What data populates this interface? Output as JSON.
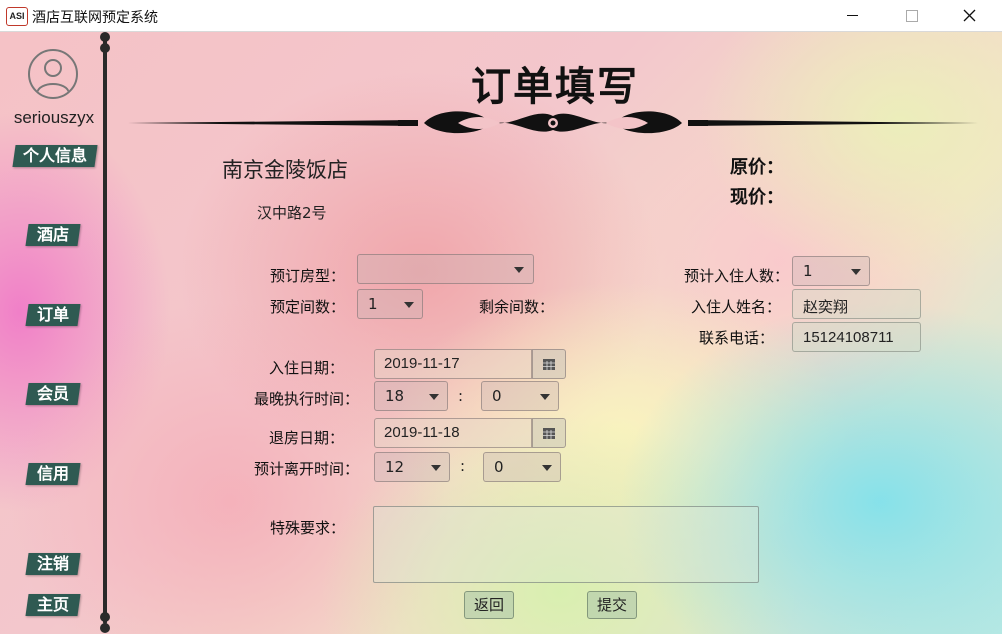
{
  "window": {
    "title": "酒店互联网预定系统",
    "logo": "ASI"
  },
  "sidebar": {
    "username": "seriouszyx",
    "items": [
      {
        "label": "个人信息"
      },
      {
        "label": "酒店"
      },
      {
        "label": "订单"
      },
      {
        "label": "会员"
      },
      {
        "label": "信用"
      },
      {
        "label": "注销"
      },
      {
        "label": "主页"
      }
    ]
  },
  "page": {
    "title": "订单填写"
  },
  "hotel": {
    "name": "南京金陵饭店",
    "address": "汉中路2号"
  },
  "price": {
    "original_label": "原价：",
    "current_label": "现价："
  },
  "form": {
    "room_type_label": "预订房型：",
    "room_type_value": "",
    "room_count_label": "预定间数：",
    "room_count_value": "1",
    "remaining_label": "剩余间数：",
    "guests_label": "预计入住人数：",
    "guests_value": "1",
    "guest_name_label": "入住人姓名：",
    "guest_name_value": "赵奕翔",
    "phone_label": "联系电话：",
    "phone_value": "15124108711",
    "checkin_label": "入住日期：",
    "checkin_value": "2019-11-17",
    "latest_time_label": "最晚执行时间：",
    "latest_hour": "18",
    "latest_minute": "0",
    "checkout_label": "退房日期：",
    "checkout_value": "2019-11-18",
    "leave_time_label": "预计离开时间：",
    "leave_hour": "12",
    "leave_minute": "0",
    "colon": ":",
    "special_label": "特殊要求：",
    "special_value": ""
  },
  "buttons": {
    "back": "返回",
    "submit": "提交"
  },
  "colors": {
    "nav_bg": "#2f5a52",
    "accent_dark": "#2a2a2a"
  }
}
